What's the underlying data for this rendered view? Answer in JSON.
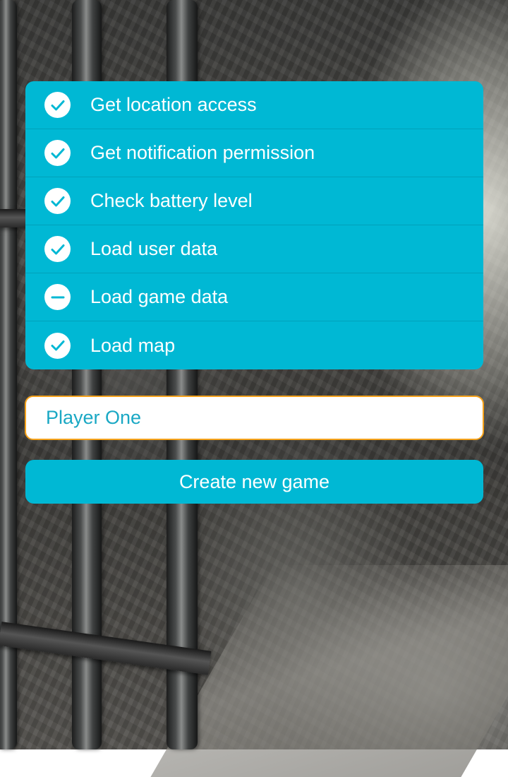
{
  "colors": {
    "accent": "#00b8d4",
    "input_border": "#f5a21b",
    "input_text": "#1aa8c4",
    "text_on_accent": "#ffffff"
  },
  "tasks": [
    {
      "label": "Get location access",
      "status": "done",
      "icon": "check-circle-icon"
    },
    {
      "label": "Get notification permission",
      "status": "done",
      "icon": "check-circle-icon"
    },
    {
      "label": "Check battery level",
      "status": "done",
      "icon": "check-circle-icon"
    },
    {
      "label": "Load user data",
      "status": "done",
      "icon": "check-circle-icon"
    },
    {
      "label": "Load game data",
      "status": "pending",
      "icon": "minus-circle-icon"
    },
    {
      "label": "Load map",
      "status": "done",
      "icon": "check-circle-icon"
    }
  ],
  "player_name": {
    "value": "Player One",
    "placeholder": "Player One"
  },
  "create_button": {
    "label": "Create new game"
  },
  "background": {
    "icon": "dungeon-wall-background"
  }
}
